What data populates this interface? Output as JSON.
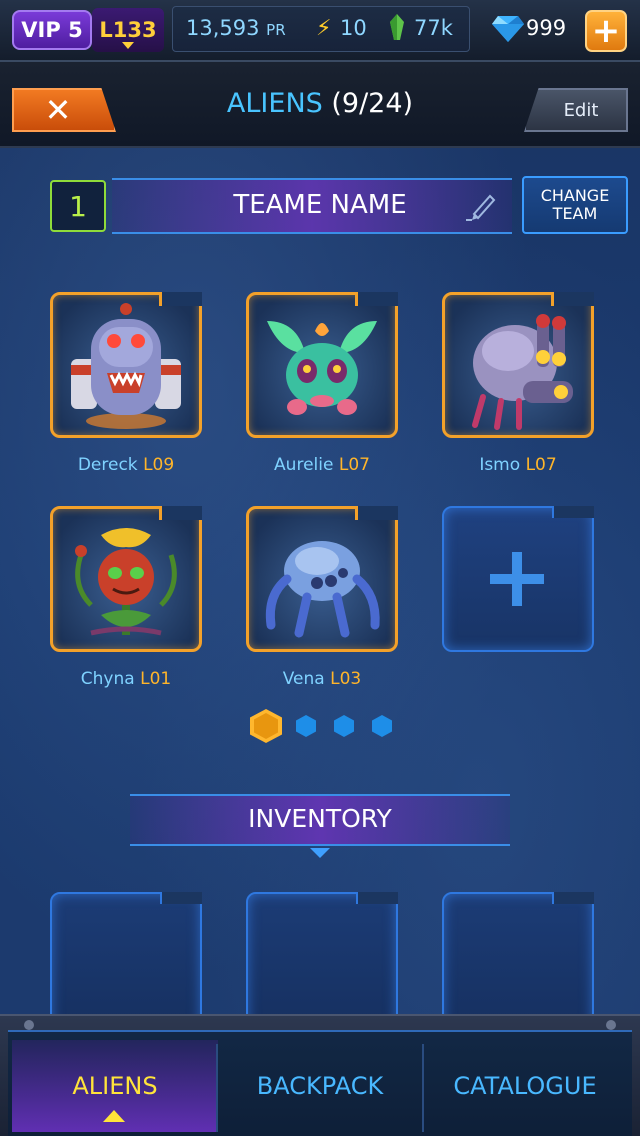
{
  "status_bar": {
    "vip_label": "VIP 5",
    "level_label": "L133",
    "power_value": "13,593",
    "power_unit": "PR",
    "energy_value": "10",
    "green_crystals": "77k",
    "diamonds": "999",
    "plus_label": "+"
  },
  "header": {
    "title": "ALIENS",
    "count": "(9/24)",
    "close_label": "✕",
    "edit_label": "Edit"
  },
  "team": {
    "number": "1",
    "name": "TEAME NAME",
    "change_line1": "CHANGE",
    "change_line2": "TEAM"
  },
  "aliens": [
    {
      "name": "Dereck",
      "level": "L09"
    },
    {
      "name": "Aurelie",
      "level": "L07"
    },
    {
      "name": "Ismo",
      "level": "L07"
    },
    {
      "name": "Chyna",
      "level": "L01"
    },
    {
      "name": "Vena",
      "level": "L03"
    }
  ],
  "pagination": {
    "pages": 4,
    "current": 1
  },
  "inventory": {
    "title": "INVENTORY"
  },
  "bottom_nav": {
    "tabs": [
      {
        "label": "ALIENS",
        "active": true
      },
      {
        "label": "BACKPACK",
        "active": false
      },
      {
        "label": "CATALOGUE",
        "active": false
      }
    ]
  },
  "colors": {
    "accent_orange": "#f3a12a",
    "accent_blue": "#49c4ff",
    "active_tab": "#ffe43a",
    "level_gold": "#ffb52a"
  }
}
